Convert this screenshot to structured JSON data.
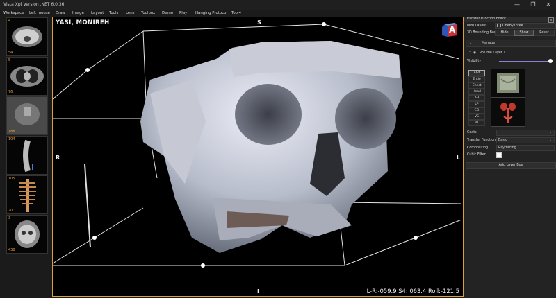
{
  "window": {
    "title": "Vista Xpf Version .NET 6.0.36"
  },
  "menu": [
    "Workspace",
    "Left mouse",
    "Draw",
    "Image",
    "Layout",
    "Tools",
    "Lens",
    "Toolbox",
    "Demo",
    "Play",
    "Hanging Protocol",
    "Tool4"
  ],
  "thumbnails": [
    {
      "number": "4",
      "count": "54"
    },
    {
      "number": "5",
      "count": "76"
    },
    {
      "number": "",
      "count": "188"
    },
    {
      "number": "104",
      "count": ""
    },
    {
      "number": "105",
      "count": "20"
    },
    {
      "number": "3",
      "count": "438"
    }
  ],
  "viewport": {
    "patient_name": "YASI, MONIREH",
    "orient_top": "S",
    "orient_left": "R",
    "orient_right": "L",
    "orient_bottom": "I",
    "readout": "L-R:-059.9  S4: 063.4  Roll:-121.5",
    "cube_label": "A"
  },
  "panel": {
    "title": "Transfer Function Editor",
    "close": "×",
    "mpr_layout_label": "MPR Layout",
    "mpr_layout_value": "OneByThree",
    "bbox_label": "3D Bounding Box",
    "bbox_buttons": [
      "Hide",
      "Show",
      "Reset"
    ],
    "manage_label": "Manage",
    "volume_layer_label": "Volume Layer 1",
    "visibility_label": "Visibility",
    "visibility_value": 1.0,
    "presets": [
      "Abd",
      "Endo",
      "Chest",
      "Head",
      "AH",
      "LP",
      "CO",
      "VS",
      "PT"
    ],
    "selected_preset": "Abd",
    "coats_label": "Coats",
    "coats_value": "",
    "transfer_function_label": "Transfer Function",
    "transfer_function_value": "Basic",
    "compositing_label": "Compositing",
    "compositing_value": "Raytracing",
    "cubic_filter_label": "Cubic Filter",
    "add_layer_label": "Add Layer Box"
  },
  "colors": {
    "accent": "#d9a13a",
    "thumb_label": "#e39a3c",
    "background": "#1b1b1b"
  }
}
